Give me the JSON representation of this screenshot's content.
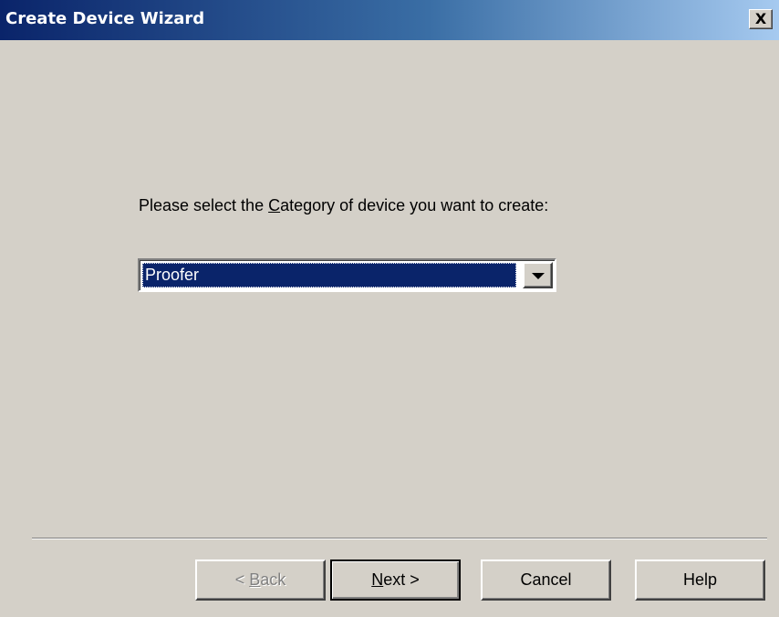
{
  "window": {
    "title": "Create Device Wizard",
    "close_label": "X"
  },
  "main": {
    "prompt_before": "Please select the ",
    "prompt_accel": "C",
    "prompt_after": "ategory of device you want to create:",
    "category_select": {
      "selected_value": "Proofer",
      "arrow_icon": "chevron-down-icon"
    }
  },
  "footer": {
    "back": {
      "prefix": "< ",
      "accel": "B",
      "rest": "ack",
      "enabled": false
    },
    "next": {
      "accel": "N",
      "rest": "ext >",
      "enabled": true,
      "default": true
    },
    "cancel_label": "Cancel",
    "help_label": "Help"
  },
  "colors": {
    "dialog_face": "#d4d0c8",
    "title_gradient_start": "#0a246a",
    "title_gradient_end": "#a6caf0",
    "selection_bg": "#0a246a",
    "disabled_text": "#808080"
  }
}
